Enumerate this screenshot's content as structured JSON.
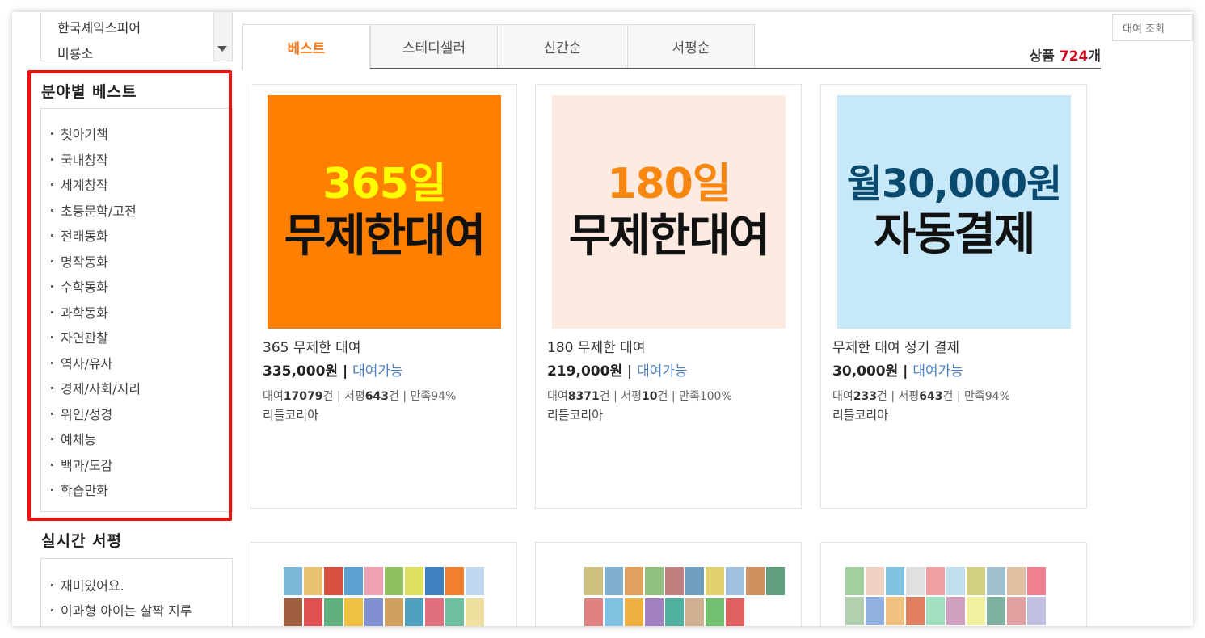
{
  "publishers": [
    "한국셰익스피어",
    "비룡소"
  ],
  "category_title": "분야별 베스트",
  "categories": [
    "첫아기책",
    "국내창작",
    "세계창작",
    "초등문학/고전",
    "전래동화",
    "명작동화",
    "수학동화",
    "과학동화",
    "자연관찰",
    "역사/유사",
    "경제/사회/지리",
    "위인/성경",
    "예체능",
    "백과/도감",
    "학습만화"
  ],
  "review_title": "실시간 서평",
  "reviews": [
    "재미있어요.",
    "이과형 아이는 살짝 지루"
  ],
  "tabs": [
    "베스트",
    "스테디셀러",
    "신간순",
    "서평순"
  ],
  "count": {
    "label": "상품",
    "value": "724",
    "unit": "개"
  },
  "side_search": "대여 조회",
  "products": [
    {
      "thumb_line1": "365일",
      "thumb_line2": "무제한대여",
      "name": "365 무제한 대여",
      "price": "335,000원",
      "sep": "|",
      "status": "대여가능",
      "stats_prefix": "대여",
      "rentals": "17079",
      "rentals_unit": "건 | 서평",
      "reviews": "643",
      "reviews_unit": "건 | 만족94%",
      "publisher": "리틀코리아"
    },
    {
      "thumb_line1": "180일",
      "thumb_line2": "무제한대여",
      "name": "180 무제한 대여",
      "price": "219,000원",
      "sep": "|",
      "status": "대여가능",
      "stats_prefix": "대여",
      "rentals": "8371",
      "rentals_unit": "건 | 서평",
      "reviews": "10",
      "reviews_unit": "건 | 만족100%",
      "publisher": "리틀코리아"
    },
    {
      "thumb_line1": "월30,000원",
      "thumb_line2": "자동결제",
      "name": "무제한 대여 정기 결제",
      "price": "30,000원",
      "sep": "|",
      "status": "대여가능",
      "stats_prefix": "대여",
      "rentals": "233",
      "rentals_unit": "건 | 서평",
      "reviews": "643",
      "reviews_unit": "건 | 만족94%",
      "publisher": "리틀코리아"
    }
  ],
  "colors": {
    "accent": "#f47b20",
    "count": "#d0021b",
    "highlight": "#ee1111",
    "status": "#4a7fc1",
    "thumb1_bg": "#ff8000",
    "thumb1_text": "#ffff00",
    "thumb2_bg": "#fdeae0",
    "thumb2_text": "#f7870f",
    "thumb3_bg": "#c6e8f8",
    "thumb3_text": "#0a4a6e"
  }
}
